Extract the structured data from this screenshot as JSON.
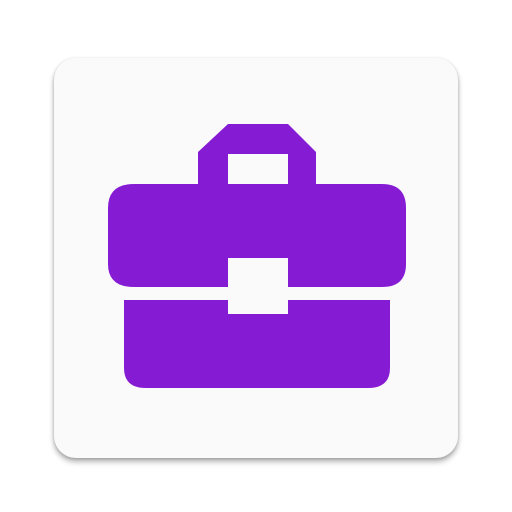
{
  "app_icon": {
    "icon_name": "briefcase-icon",
    "glyph_color": "#861bd4",
    "tile_color": "#fafafa"
  }
}
